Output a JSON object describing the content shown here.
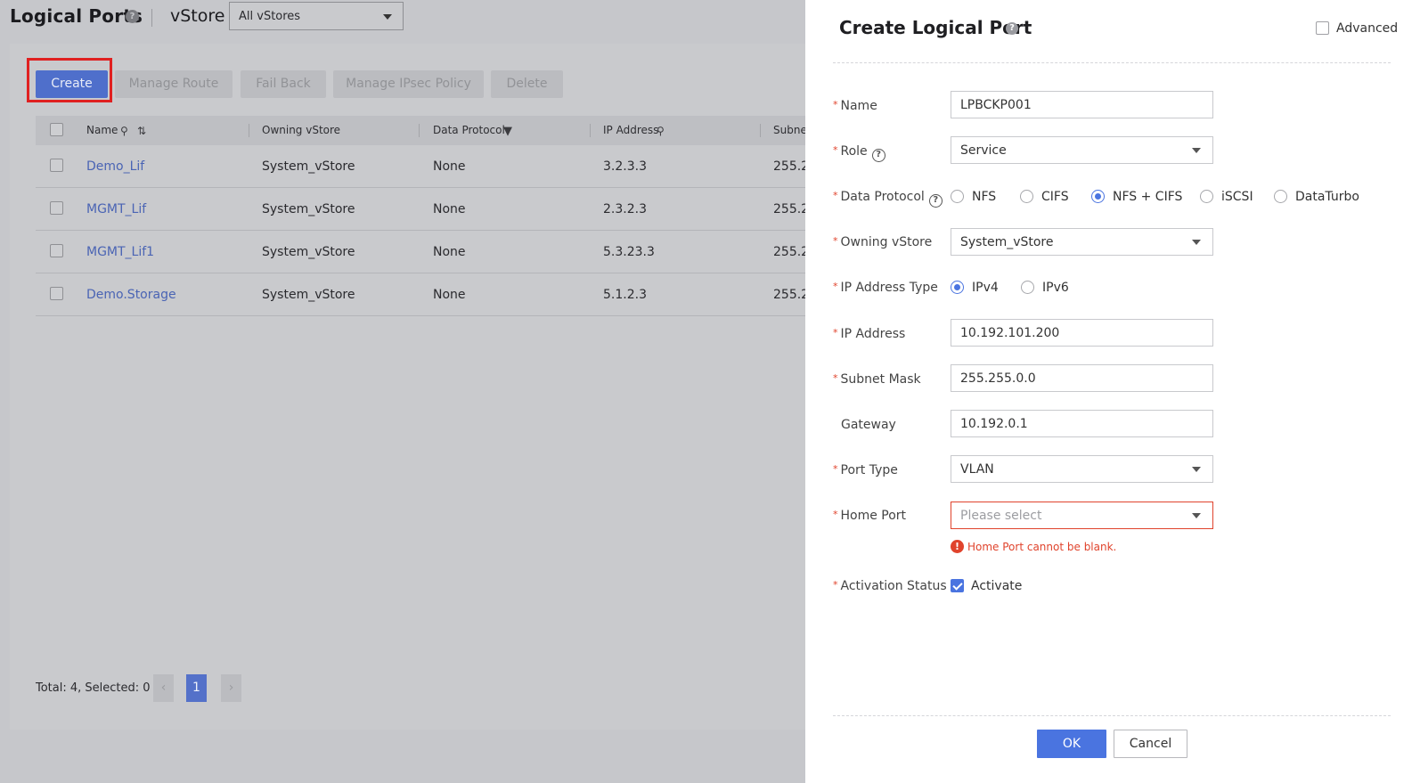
{
  "page": {
    "title": "Logical Ports",
    "vstore_label": "vStore",
    "vstore_value": "All vStores"
  },
  "toolbar": {
    "create": "Create",
    "manage_route": "Manage Route",
    "fail_back": "Fail Back",
    "manage_ipsec": "Manage IPsec Policy",
    "delete": "Delete"
  },
  "table": {
    "headers": [
      "Name",
      "Owning vStore",
      "Data Protocol",
      "IP Address",
      "Subnet"
    ],
    "rows": [
      {
        "name": "Demo_Lif",
        "vstore": "System_vStore",
        "protocol": "None",
        "ip": "3.2.3.3",
        "subnet": "255.2"
      },
      {
        "name": "MGMT_Lif",
        "vstore": "System_vStore",
        "protocol": "None",
        "ip": "2.3.2.3",
        "subnet": "255.2"
      },
      {
        "name": "MGMT_Lif1",
        "vstore": "System_vStore",
        "protocol": "None",
        "ip": "5.3.23.3",
        "subnet": "255.2"
      },
      {
        "name": "Demo.Storage",
        "vstore": "System_vStore",
        "protocol": "None",
        "ip": "5.1.2.3",
        "subnet": "255.2"
      }
    ]
  },
  "pager": {
    "summary": "Total: 4, Selected: 0",
    "current": "1"
  },
  "drawer": {
    "title": "Create Logical Port",
    "advanced": "Advanced",
    "fields": {
      "name_label": "Name",
      "name_value": "LPBCKP001",
      "role_label": "Role",
      "role_value": "Service",
      "protocol_label": "Data Protocol",
      "protocol_options": [
        "NFS",
        "CIFS",
        "NFS + CIFS",
        "iSCSI",
        "DataTurbo"
      ],
      "protocol_selected": "NFS + CIFS",
      "owning_label": "Owning vStore",
      "owning_value": "System_vStore",
      "iptype_label": "IP Address Type",
      "iptype_options": [
        "IPv4",
        "IPv6"
      ],
      "iptype_selected": "IPv4",
      "ip_label": "IP Address",
      "ip_value": "10.192.101.200",
      "mask_label": "Subnet Mask",
      "mask_value": "255.255.0.0",
      "gateway_label": "Gateway",
      "gateway_value": "10.192.0.1",
      "porttype_label": "Port Type",
      "porttype_value": "VLAN",
      "homeport_label": "Home Port",
      "homeport_placeholder": "Please select",
      "homeport_error": "Home Port cannot be blank.",
      "activation_label": "Activation Status",
      "activation_value": "Activate"
    },
    "ok": "OK",
    "cancel": "Cancel"
  },
  "colors": {
    "accent": "#4a74e0",
    "error": "#e0432c",
    "highlight": "#e02020"
  }
}
